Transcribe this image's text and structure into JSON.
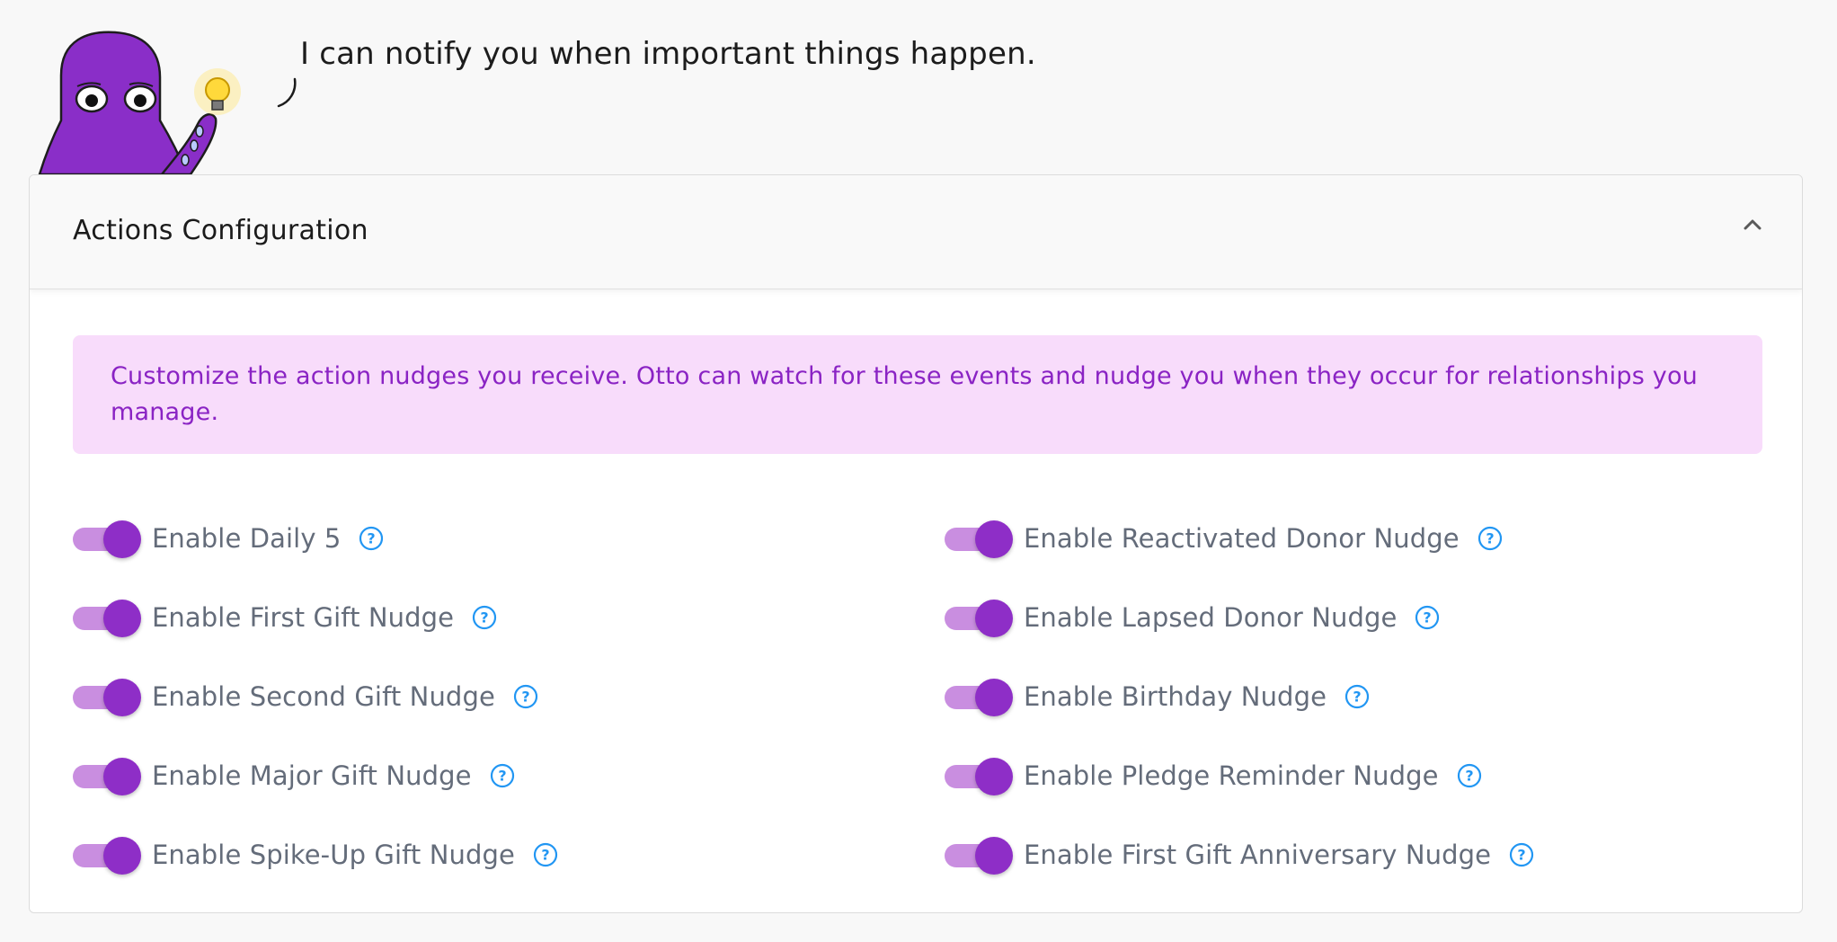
{
  "assistant": {
    "message": "I can notify you when important things happen."
  },
  "card": {
    "title": "Actions Configuration",
    "info_text": "Customize the action nudges you receive. Otto can watch for these events and nudge you when they occur for relationships you manage."
  },
  "colors": {
    "accent": "#8e2ec7",
    "toggle_track": "#c98ee0",
    "info_background": "#f8dcfb",
    "info_text": "#8a23c4",
    "help_icon": "#2196f3"
  },
  "nudges_left": [
    {
      "label": "Enable Daily 5",
      "enabled": true
    },
    {
      "label": "Enable First Gift Nudge",
      "enabled": true
    },
    {
      "label": "Enable Second Gift Nudge",
      "enabled": true
    },
    {
      "label": "Enable Major Gift Nudge",
      "enabled": true
    },
    {
      "label": "Enable Spike-Up Gift Nudge",
      "enabled": true
    }
  ],
  "nudges_right": [
    {
      "label": "Enable Reactivated Donor Nudge",
      "enabled": true
    },
    {
      "label": "Enable Lapsed Donor Nudge",
      "enabled": true
    },
    {
      "label": "Enable Birthday Nudge",
      "enabled": true
    },
    {
      "label": "Enable Pledge Reminder Nudge",
      "enabled": true
    },
    {
      "label": "Enable First Gift Anniversary Nudge",
      "enabled": true
    }
  ]
}
